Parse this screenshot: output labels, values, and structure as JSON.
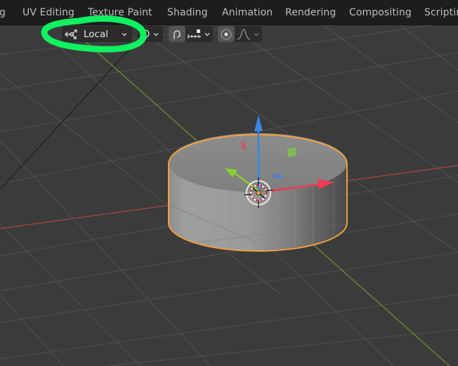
{
  "workspace_tabs": [
    {
      "label": "g"
    },
    {
      "label": "UV Editing"
    },
    {
      "label": "Texture Paint"
    },
    {
      "label": "Shading"
    },
    {
      "label": "Animation"
    },
    {
      "label": "Rendering"
    },
    {
      "label": "Compositing"
    },
    {
      "label": "Scriptin"
    }
  ],
  "viewport_header": {
    "transform_orientation": {
      "icon": "orientation-local-icon",
      "value": "Local"
    },
    "pivot_point": {
      "icon": "pivot-point-icon"
    },
    "snap": {
      "icon": "magnet-snap-icon",
      "target_icon": "snap-increment-icon",
      "active": true
    },
    "proportional_edit": {
      "icon": "proportional-edit-icon",
      "falloff_icon": "falloff-smooth-icon",
      "active": true
    }
  },
  "scene": {
    "object": "cylinder",
    "selected": true,
    "colors": {
      "background": "#3b3b3b",
      "grid": "#4f4f4f",
      "x_axis": "#a8404c",
      "y_axis": "#6b8f2e",
      "selection_outline": "#f0a040",
      "gizmo_x": "#ee3a52",
      "gizmo_y": "#88d02e",
      "gizmo_z": "#3a86e6",
      "annotation": "#10f060"
    }
  }
}
